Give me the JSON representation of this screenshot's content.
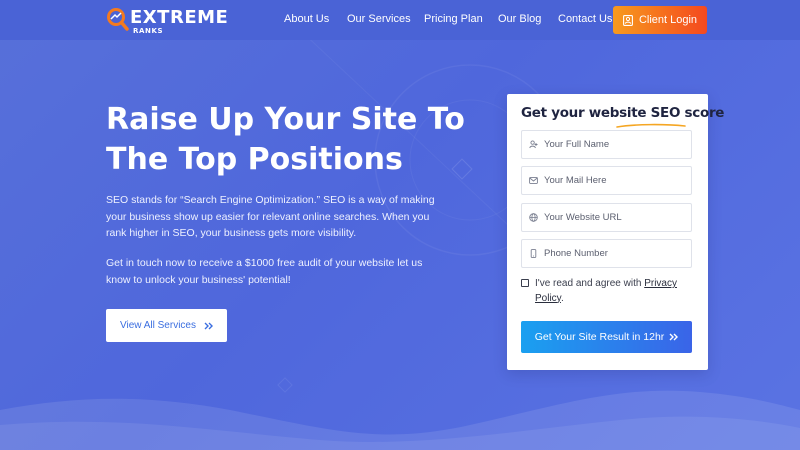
{
  "brand": {
    "name": "EXTREME",
    "tagline": "RANKS",
    "colors": {
      "accent": "#f47a1f",
      "primary": "#4f67dc",
      "button_blue": "#2c7be5"
    }
  },
  "nav": {
    "items": [
      "About Us",
      "Our Services",
      "Pricing Plan",
      "Our Blog",
      "Contact Us"
    ],
    "login_label": "Client Login",
    "login_icon": "user-card-icon"
  },
  "hero": {
    "title_line1": "Raise Up Your Site To",
    "title_line2": "The Top Positions",
    "paragraph1": "SEO stands for “Search Engine Optimization.” SEO is a way of making your business show up easier for relevant online searches. When you rank higher in SEO, your business gets more visibility.",
    "paragraph2": "Get in touch now to receive a $1000 free audit of your website let us know to unlock your business' potential!",
    "cta_label": "View All Services",
    "cta_icon": "double-chevron-right-icon"
  },
  "form": {
    "title_prefix": "Get your website ",
    "title_highlight": "SEO score",
    "fields": [
      {
        "placeholder": "Your Full Name",
        "icon": "user-add-icon"
      },
      {
        "placeholder": "Your Mail Here",
        "icon": "mail-icon"
      },
      {
        "placeholder": "Your Website URL",
        "icon": "globe-icon"
      },
      {
        "placeholder": "Phone Number",
        "icon": "phone-icon"
      }
    ],
    "agree_text": "I've read and agree with ",
    "agree_link": "Privacy Policy",
    "agree_end": ".",
    "submit_label": "Get Your Site Result in 12hr",
    "submit_icon": "double-chevron-right-icon"
  }
}
